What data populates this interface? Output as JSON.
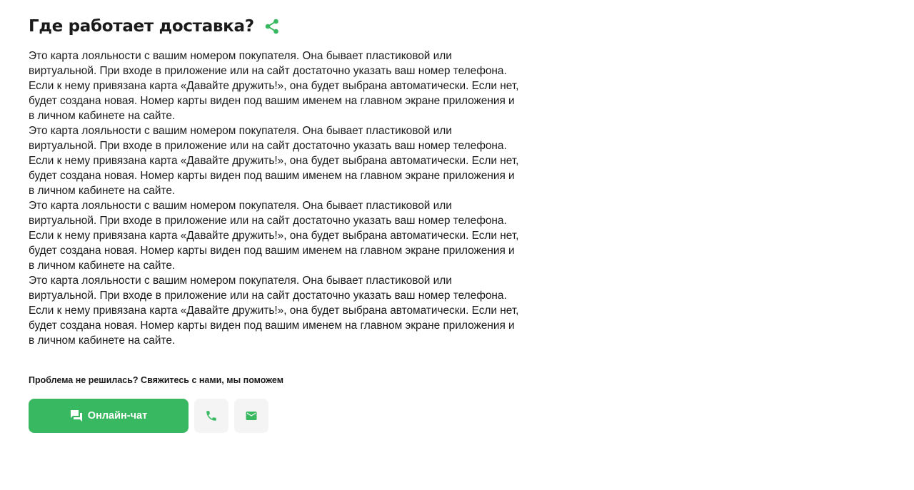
{
  "page": {
    "title": "Где работает доставка?"
  },
  "article": {
    "paragraphs": [
      "Это карта лояльности с вашим номером покупателя. Она бывает пластиковой или виртуальной. При входе в приложение или на сайт достаточно указать ваш номер телефона. Если к нему привязана карта «Давайте дружить!», она будет выбрана автоматически. Если нет, будет создана новая. Номер карты виден под вашим именем на главном экране приложения и в личном кабинете на сайте.",
      "Это карта лояльности с вашим номером покупателя. Она бывает пластиковой или виртуальной. При входе в приложение или на сайт достаточно указать ваш номер телефона. Если к нему привязана карта «Давайте дружить!», она будет выбрана автоматически. Если нет, будет создана новая. Номер карты виден под вашим именем на главном экране приложения и в личном кабинете на сайте.",
      "Это карта лояльности с вашим номером покупателя. Она бывает пластиковой или виртуальной. При входе в приложение или на сайт достаточно указать ваш номер телефона. Если к нему привязана карта «Давайте дружить!», она будет выбрана автоматически. Если нет, будет создана новая. Номер карты виден под вашим именем на главном экране приложения и в личном кабинете на сайте.",
      "Это карта лояльности с вашим номером покупателя. Она бывает пластиковой или виртуальной. При входе в приложение или на сайт достаточно указать ваш номер телефона. Если к нему привязана карта «Давайте дружить!», она будет выбрана автоматически. Если нет, будет создана новая. Номер карты виден под вашим именем на главном экране приложения и в личном кабинете на сайте."
    ]
  },
  "support": {
    "prompt": "Проблема не решилась? Свяжитесь с нами, мы поможем",
    "chat_label": "Онлайн-чат"
  },
  "icons": {
    "share": "share-icon",
    "chat": "chat-icon",
    "phone": "phone-icon",
    "mail": "mail-icon"
  },
  "colors": {
    "accent": "#38b961",
    "icon_button_bg": "#f4f4f4",
    "text": "#1a1a1a"
  }
}
